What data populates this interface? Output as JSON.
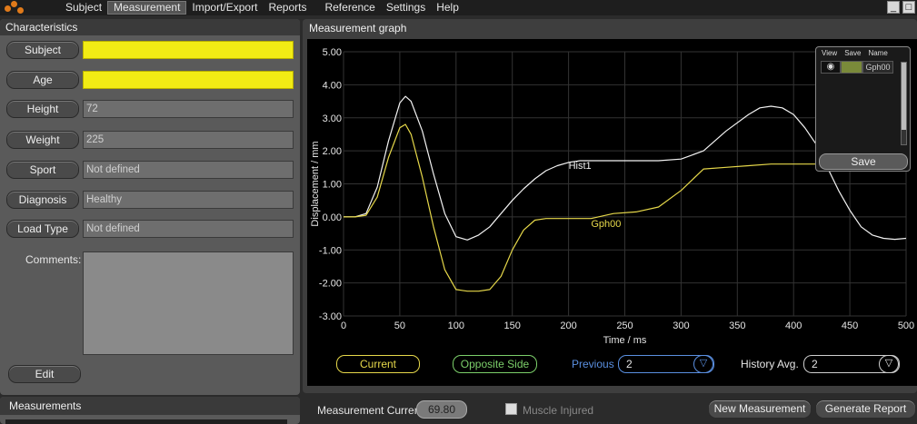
{
  "menu": {
    "items": [
      {
        "label": "Subject"
      },
      {
        "label": "Measurement"
      },
      {
        "label": "Import/Export"
      },
      {
        "label": "Reports"
      },
      {
        "label": "Reference"
      },
      {
        "label": "Settings"
      },
      {
        "label": "Help"
      }
    ],
    "active_index": 1,
    "minimize": "_",
    "close": "□"
  },
  "characteristics": {
    "title": "Characteristics",
    "fields": [
      {
        "label": "Subject",
        "value": "",
        "highlight": true
      },
      {
        "label": "Age",
        "value": "",
        "highlight": true
      },
      {
        "label": "Height",
        "value": "72",
        "highlight": false
      },
      {
        "label": "Weight",
        "value": "225",
        "highlight": false
      },
      {
        "label": "Sport",
        "value": "Not defined",
        "highlight": false
      },
      {
        "label": "Diagnosis",
        "value": "Healthy",
        "highlight": false
      },
      {
        "label": "Load Type",
        "value": "Not defined",
        "highlight": false
      }
    ],
    "comments_label": "Comments:",
    "comments_value": "",
    "edit_label": "Edit"
  },
  "measurements": {
    "title": "Measurements"
  },
  "graph": {
    "title": "Measurement graph",
    "legend": {
      "current": "Current",
      "opposite": "Opposite Side"
    },
    "previous": {
      "label": "Previous",
      "value": "2"
    },
    "history_avg": {
      "label": "History Avg.",
      "value": "2"
    },
    "history_box": {
      "headers": [
        "View",
        "Save",
        "Name"
      ],
      "rows": [
        {
          "name": "Gph00"
        }
      ],
      "save_label": "Save"
    }
  },
  "chart_data": {
    "type": "line",
    "xlabel": "Time / ms",
    "ylabel": "Displacement / mm",
    "xlim": [
      0,
      500
    ],
    "ylim": [
      -3,
      5
    ],
    "xticks": [
      "0",
      "50",
      "100",
      "150",
      "200",
      "250",
      "300",
      "350",
      "400",
      "450",
      "500"
    ],
    "yticks": [
      "5.00",
      "4.00",
      "3.00",
      "2.00",
      "1.00",
      "0.00",
      "-1.00",
      "-2.00",
      "-3.00"
    ],
    "grid": true,
    "series": [
      {
        "name": "Hist1",
        "color": "#f2f2f2",
        "x": [
          0,
          10,
          20,
          30,
          40,
          50,
          55,
          60,
          70,
          80,
          90,
          100,
          110,
          120,
          130,
          140,
          150,
          160,
          170,
          180,
          190,
          200,
          210,
          220,
          240,
          260,
          280,
          300,
          320,
          340,
          360,
          370,
          380,
          390,
          400,
          410,
          420,
          430,
          440,
          450,
          460,
          470,
          480,
          490,
          500
        ],
        "y": [
          0.0,
          0.0,
          0.1,
          0.9,
          2.3,
          3.45,
          3.65,
          3.5,
          2.6,
          1.3,
          0.1,
          -0.6,
          -0.7,
          -0.55,
          -0.3,
          0.1,
          0.5,
          0.85,
          1.15,
          1.4,
          1.55,
          1.65,
          1.7,
          1.7,
          1.7,
          1.7,
          1.7,
          1.75,
          2.0,
          2.6,
          3.1,
          3.3,
          3.35,
          3.3,
          3.1,
          2.7,
          2.2,
          1.5,
          0.8,
          0.2,
          -0.3,
          -0.55,
          -0.65,
          -0.68,
          -0.65
        ]
      },
      {
        "name": "Gph00",
        "color": "#e6d84a",
        "x": [
          0,
          10,
          20,
          30,
          40,
          50,
          55,
          60,
          70,
          80,
          90,
          100,
          110,
          120,
          130,
          140,
          150,
          160,
          170,
          180,
          190,
          200,
          210,
          220,
          240,
          260,
          280,
          300,
          320,
          340,
          360,
          380,
          400,
          420,
          440,
          450
        ],
        "y": [
          0.0,
          0.0,
          0.05,
          0.6,
          1.8,
          2.7,
          2.8,
          2.5,
          1.2,
          -0.3,
          -1.6,
          -2.2,
          -2.25,
          -2.25,
          -2.2,
          -1.8,
          -1.0,
          -0.4,
          -0.1,
          -0.05,
          -0.05,
          -0.05,
          -0.05,
          -0.05,
          0.1,
          0.15,
          0.3,
          0.8,
          1.45,
          1.5,
          1.55,
          1.6,
          1.6,
          1.6,
          1.6,
          1.6
        ]
      }
    ]
  },
  "bottom": {
    "measurement_current_label": "Measurement Current:",
    "measurement_current_value": "69.80",
    "muscle_injured_label": "Muscle Injured",
    "new_measurement_label": "New Measurement",
    "generate_report_label": "Generate Report"
  }
}
